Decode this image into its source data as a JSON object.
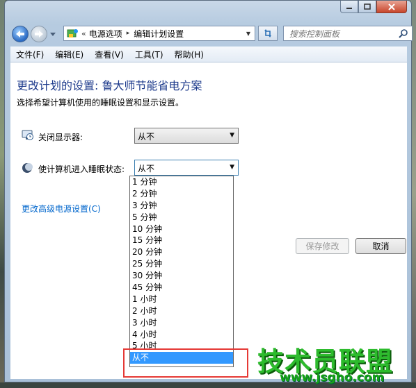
{
  "window": {
    "caption_buttons": [
      "minimize",
      "maximize",
      "close"
    ]
  },
  "address": {
    "breadcrumb_sep": "«",
    "crumbs": [
      "电源选项",
      "编辑计划设置"
    ],
    "arrow": "▸"
  },
  "search": {
    "placeholder": "搜索控制面板"
  },
  "menu": [
    "文件(F)",
    "编辑(E)",
    "查看(V)",
    "工具(T)",
    "帮助(H)"
  ],
  "content": {
    "title": "更改计划的设置: 鲁大师节能省电方案",
    "subtitle": "选择希望计算机使用的睡眠设置和显示设置。",
    "display_off": {
      "label": "关闭显示器:",
      "value": "从不",
      "icon": "monitor-clock-icon"
    },
    "sleep": {
      "label": "使计算机进入睡眠状态:",
      "value": "从不",
      "icon": "moon-icon"
    },
    "advanced_link": "更改高级电源设置(C)",
    "save_button": "保存修改",
    "cancel_button": "取消"
  },
  "dropdown": {
    "options": [
      "1 分钟",
      "2 分钟",
      "3 分钟",
      "5 分钟",
      "10 分钟",
      "15 分钟",
      "20 分钟",
      "25 分钟",
      "30 分钟",
      "45 分钟",
      "1 小时",
      "2 小时",
      "3 小时",
      "4 小时",
      "5 小时",
      "从不"
    ],
    "selected_index": 15,
    "highlight_color": "#3399ff"
  },
  "watermark": {
    "text": "技术员联盟",
    "url": "www.jsgho.com",
    "color": "#2dbb2d"
  },
  "colors": {
    "title": "#1e3b8c",
    "link": "#0066cc",
    "annotation_box": "#e53935"
  }
}
